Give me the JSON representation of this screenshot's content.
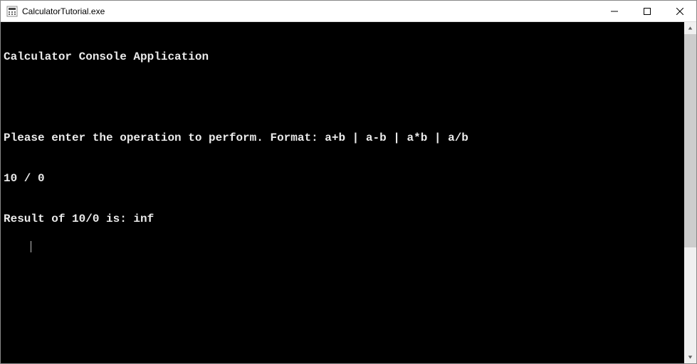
{
  "window": {
    "title": "CalculatorTutorial.exe"
  },
  "console": {
    "lines": [
      "Calculator Console Application",
      "",
      "Please enter the operation to perform. Format: a+b | a-b | a*b | a/b",
      "10 / 0",
      "Result of 10/0 is: inf"
    ]
  }
}
